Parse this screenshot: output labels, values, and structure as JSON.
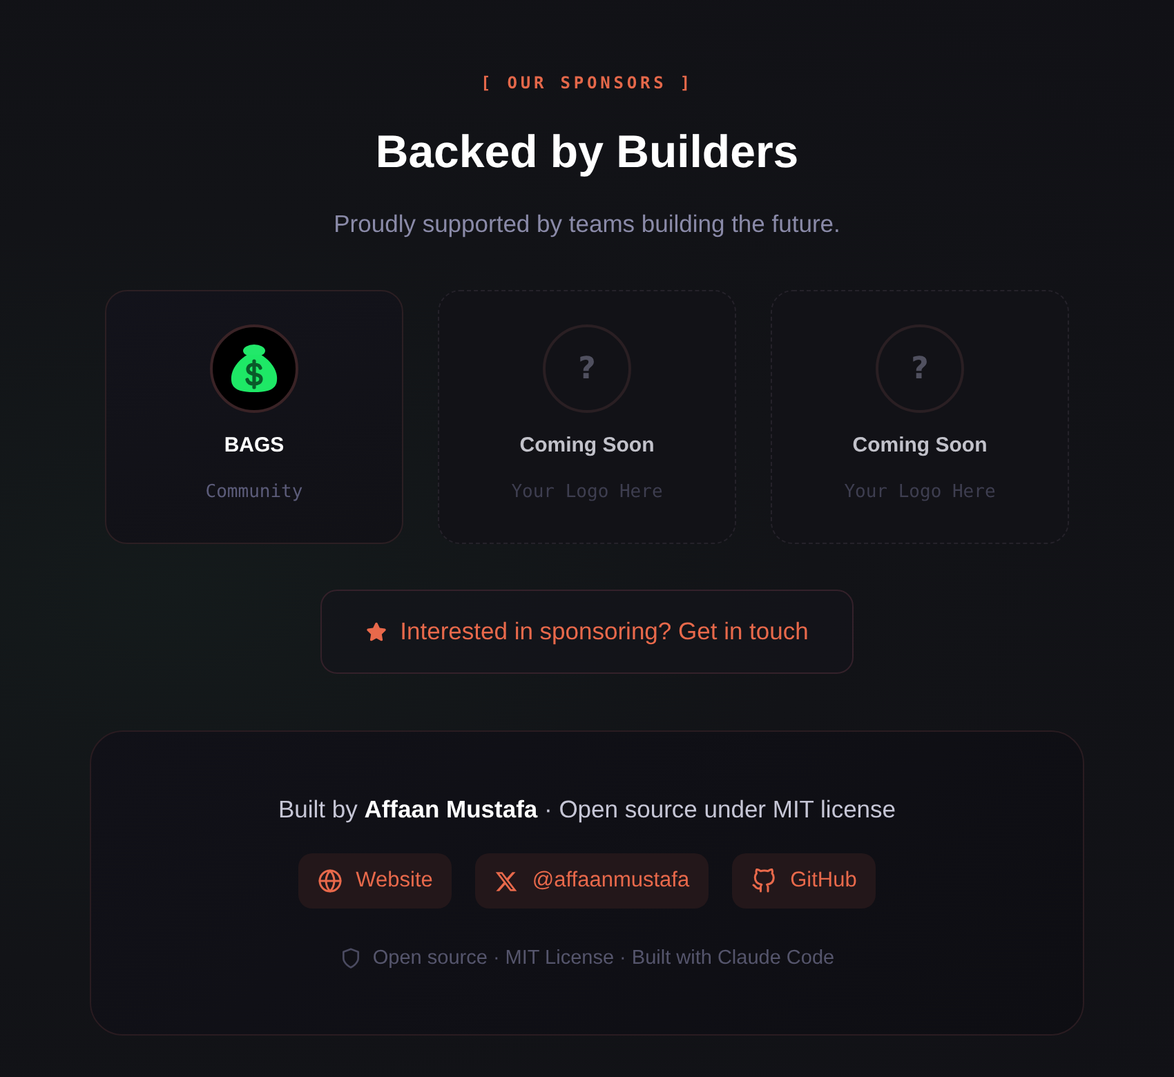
{
  "eyebrow": "[ OUR SPONSORS ]",
  "title": "Backed by Builders",
  "subtitle": "Proudly supported by teams building the future.",
  "sponsors": [
    {
      "kind": "sponsor",
      "name": "BAGS",
      "tagline": "Community"
    },
    {
      "kind": "placeholder",
      "mark": "?",
      "name": "Coming Soon",
      "tagline": "Your Logo Here"
    },
    {
      "kind": "placeholder",
      "mark": "?",
      "name": "Coming Soon",
      "tagline": "Your Logo Here"
    }
  ],
  "cta": {
    "label": "Interested in sponsoring? Get in touch"
  },
  "footer": {
    "credit": "Built by **Affaan Mustafa** · Open source under MIT license",
    "links": [
      {
        "kind": "website",
        "label": "Website"
      },
      {
        "kind": "x",
        "label": "@affaanmustafa"
      },
      {
        "kind": "github",
        "label": "GitHub"
      }
    ],
    "note": "Open source · MIT License · Built with Claude Code"
  }
}
